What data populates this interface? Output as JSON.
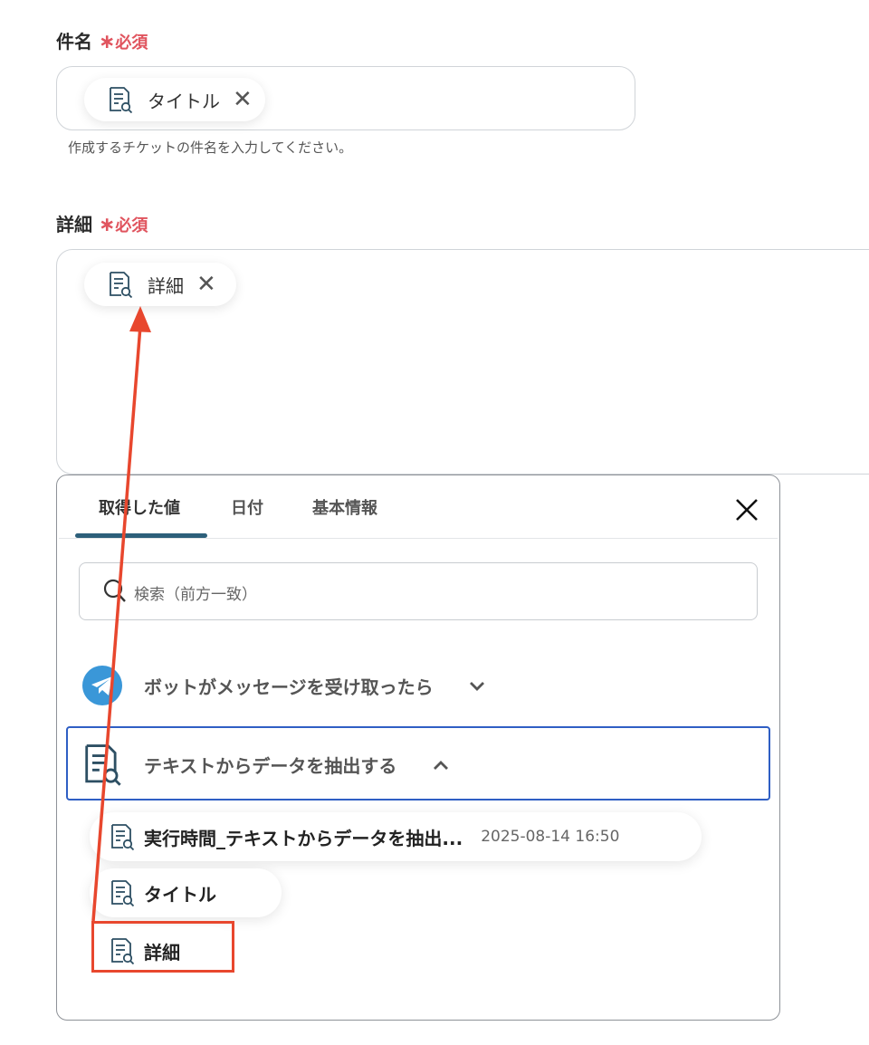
{
  "subject_field": {
    "label": "件名",
    "required_mark": "∗",
    "required_text": "必須",
    "chip_label": "タイトル",
    "help_text": "作成するチケットの件名を入力してください。"
  },
  "detail_field": {
    "label": "詳細",
    "required_mark": "∗",
    "required_text": "必須",
    "chip_label": "詳細"
  },
  "picker": {
    "tabs": [
      {
        "label": "取得した値",
        "active": true
      },
      {
        "label": "日付",
        "active": false
      },
      {
        "label": "基本情報",
        "active": false
      }
    ],
    "search_placeholder": "検索（前方一致）",
    "sections": [
      {
        "label": "ボットがメッセージを受け取ったら",
        "icon": "telegram-icon",
        "expanded": false
      },
      {
        "label": "テキストからデータを抽出する",
        "icon": "document-search-icon",
        "expanded": true
      }
    ],
    "items": [
      {
        "label": "実行時間_テキストからデータを抽出...",
        "value": "2025-08-14 16:50"
      },
      {
        "label": "タイトル",
        "value": ""
      },
      {
        "label": "詳細",
        "value": ""
      }
    ]
  },
  "colors": {
    "required": "#e0545e",
    "tab_underline": "#2d5f7a",
    "selected_border": "#2f5fc4",
    "annotation": "#e8472e",
    "telegram": "#3a97d8"
  }
}
